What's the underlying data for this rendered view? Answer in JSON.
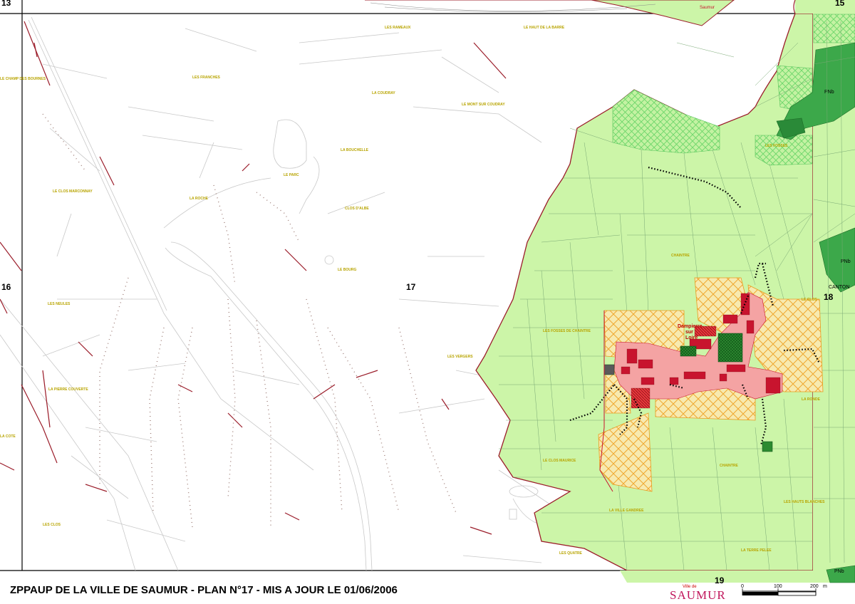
{
  "grid_labels": {
    "top_left": "13",
    "top_right": "15",
    "left": "16",
    "center": "17",
    "right": "18",
    "bottom": "19"
  },
  "village": {
    "name_line1": "Dampierre",
    "name_line2": "sur",
    "name_line3": "Loire"
  },
  "top_town": "Saumur",
  "zones": [
    "PNb",
    "PNb",
    "PNb",
    "PNb"
  ],
  "places": {
    "p1": "LES RAMEAUX",
    "p2": "LE CHAMP DES BOURNES",
    "p3": "LE HAUT DE LA BARRE",
    "p4": "LES FRANCHES",
    "p5": "LA COUDRAY",
    "p6": "LE MONT SUR COUDRAY",
    "p7": "LA BOUCHELLE",
    "p8": "LE CLOS MARCONNAY",
    "p9": "LA ROCHE",
    "p10": "LE PARC",
    "p11": "CLOS D'ALBE",
    "p12": "LE BOURG",
    "p13": "LES NEULES",
    "p14": "LA PIERRE COUVERTE",
    "p15": "LES CLOS",
    "p16": "CHAINTRE",
    "p17": "LES FOSSES DE CHAINTRE",
    "p18": "LE CLOS MAURICE",
    "p19": "LA VILLE GANDREE",
    "p20": "LA TERRE PELEE",
    "p21": "LA RONDE",
    "p22": "CHAINTRE",
    "p23": "LES HAUTS BLANCHES",
    "p24": "LES FOSSES",
    "p25": "LES VERGERS",
    "p26": "CANTON",
    "p27": "LE CLOS",
    "p28": "LES QUATRE",
    "p29": "LA COTE"
  },
  "footer": {
    "title": "ZPPAUP DE LA VILLE DE SAUMUR - PLAN N°17 - MIS A JOUR LE  01/06/2006",
    "logo_small": "Ville de",
    "logo_main": "SAUMUR",
    "scale_0": "0",
    "scale_100": "100",
    "scale_200": "200",
    "scale_unit": "m"
  },
  "colors": {
    "rural_green": "#ccf5a8",
    "dark_green": "#3ca84a",
    "hatched_green": "#8ee08a",
    "village_pink": "#f4a3a3",
    "village_red": "#c8142e",
    "orange_hatch": "#f2b24a",
    "road_gray": "#b8b8b8",
    "boundary": "#9b1d2a"
  }
}
